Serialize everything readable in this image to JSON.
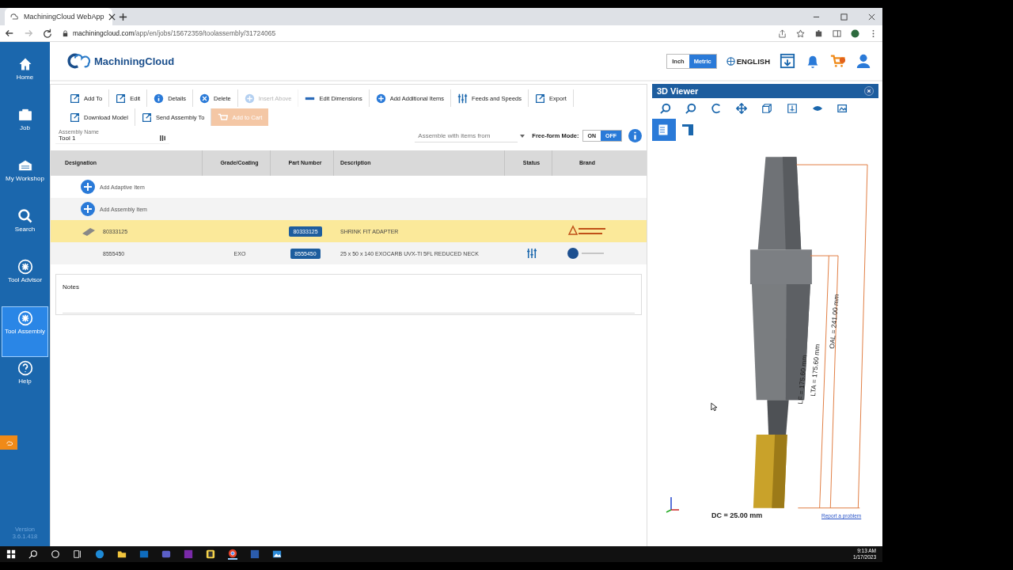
{
  "browser": {
    "tab_title": "MachiningCloud WebApp",
    "url_host": "machiningcloud.com",
    "url_path": "/app/en/jobs/15672359/toolassembly/31724065"
  },
  "sidebar": {
    "items": [
      {
        "label": "Home",
        "selected": false
      },
      {
        "label": "Job",
        "selected": false
      },
      {
        "label": "My Workshop",
        "selected": false
      },
      {
        "label": "Search",
        "selected": false
      },
      {
        "label": "Tool Advisor",
        "selected": false
      },
      {
        "label": "Tool Assembly",
        "selected": true
      },
      {
        "label": "Help",
        "selected": false
      }
    ],
    "version": "Version 3.6.1.418"
  },
  "header": {
    "logo": "MachiningCloud",
    "units": [
      {
        "label": "Inch",
        "selected": false
      },
      {
        "label": "Metric",
        "selected": true
      }
    ],
    "language": "ENGLISH"
  },
  "toolbar": {
    "items": [
      {
        "label": "Add To",
        "disabled": false
      },
      {
        "label": "Edit",
        "disabled": false
      },
      {
        "label": "Details",
        "disabled": false
      },
      {
        "label": "Delete",
        "disabled": false
      },
      {
        "label": "Insert Above",
        "disabled": true
      },
      {
        "label": "Edit Dimensions",
        "disabled": false
      },
      {
        "label": "Add Additional Items",
        "disabled": false
      },
      {
        "label": "Feeds and Speeds",
        "disabled": false
      },
      {
        "label": "Export",
        "disabled": false
      },
      {
        "label": "Download Model",
        "disabled": false
      },
      {
        "label": "Send Assembly To",
        "disabled": false
      },
      {
        "label": "Add to Cart",
        "disabled": true
      }
    ]
  },
  "assembly_name": {
    "label": "Assembly Name",
    "value": "Tool 1"
  },
  "assemble_select": {
    "placeholder": "Assemble with items from"
  },
  "free_form": {
    "label": "Free-form Mode:",
    "options": [
      {
        "label": "ON",
        "selected": false
      },
      {
        "label": "OFF",
        "selected": true
      }
    ]
  },
  "table": {
    "columns": [
      "Designation",
      "Grade/Coating",
      "Part Number",
      "Description",
      "Status",
      "Brand"
    ],
    "rows": [
      {
        "kind": "add",
        "label": "Add Adaptive Item"
      },
      {
        "kind": "add",
        "label": "Add Assembly Item"
      },
      {
        "kind": "item",
        "selected": true,
        "designation": "80333125",
        "part_number": "80333125",
        "description": "SHRINK FIT ADAPTER",
        "status": false
      },
      {
        "kind": "item",
        "selected": false,
        "designation": "8555450",
        "grade": "EXO",
        "part_number": "8555450",
        "description": "25 x 50 x 140 EXOCARB UVX-TI 5FL REDUCED NECK",
        "status": true
      }
    ]
  },
  "notes": {
    "label": "Notes"
  },
  "viewer": {
    "title": "3D Viewer",
    "dimensions": {
      "oal": "OAL = 241.00 mm",
      "lta": "LTA = 175.60 mm",
      "lf": "LF = 175.60 mm",
      "dc": "DC = 25.00 mm"
    },
    "report_link": "Report a problem"
  },
  "taskbar": {
    "time": "9:13 AM",
    "date": "1/17/2023"
  }
}
